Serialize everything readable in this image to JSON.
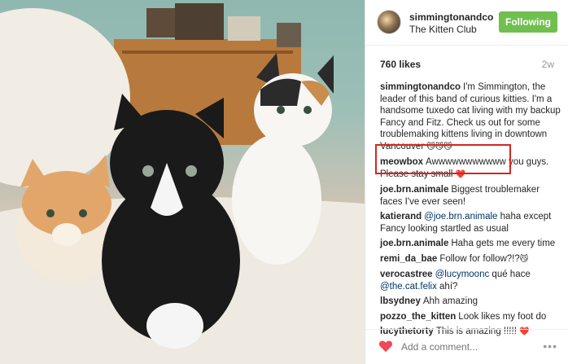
{
  "photo": {
    "alt_icon": "kittens-photo"
  },
  "header": {
    "username": "simmingtonandco",
    "location": "The Kitten Club",
    "follow_label": "Following"
  },
  "meta": {
    "likes": "760 likes",
    "time": "2w"
  },
  "comments": [
    {
      "user": "simmingtonandco",
      "text": "I'm Simmington, the leader of this band of curious kitties. I'm a handsome tuxedo cat living with my backup Fancy and Fitz. Check us out for some troublemaking kittens living in downtown Vancouver ",
      "emoji": "😼😼😼"
    },
    {
      "user": "meowbox",
      "text": "Awwwwwwwwwww you guys. Please stay small ",
      "emoji": "❤️"
    },
    {
      "user": "joe.brn.animale",
      "text": "Biggest troublemaker faces I've ever seen!"
    },
    {
      "user": "katierand",
      "mention": "@joe.brn.animale",
      "text": " haha except Fancy looking startled as usual"
    },
    {
      "user": "joe.brn.animale",
      "text": "Haha gets me every time"
    },
    {
      "user": "remi_da_bae",
      "text": "Follow for follow?!?",
      "emoji": "😼"
    },
    {
      "user": "verocastree",
      "mention": "@lucymoonc",
      "text": " qué hace ",
      "mention2": "@the.cat.felix",
      "text2": " ahí?"
    },
    {
      "user": "lbsydney",
      "text": "Ahh amazing"
    },
    {
      "user": "pozzo_the_kitten",
      "text": "Look likes my foot do"
    },
    {
      "user": "lucythetorty",
      "text": "This is amazing !!!!! ",
      "emoji": "❤️"
    }
  ],
  "footer": {
    "comment_placeholder": "Add a comment...",
    "more_label": "•••"
  },
  "colors": {
    "follow_bg": "#70c050",
    "highlight": "#d3281f",
    "heart": "#ed4956"
  }
}
